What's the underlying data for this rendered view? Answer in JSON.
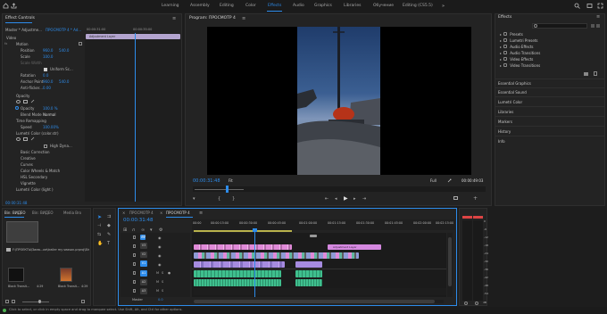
{
  "workspaces": [
    "Learning",
    "Assembly",
    "Editing",
    "Color",
    "Effects",
    "Audio",
    "Graphics",
    "Libraries",
    "Обучение",
    "Editing (CS5.5)"
  ],
  "active_workspace": "Effects",
  "effect_controls": {
    "title": "Effect Controls",
    "source": "Master * Adjustme...",
    "clip": "ПРОСМОТР 4 * Ad...",
    "mini_time": "00:00:31:00",
    "mini_time2": "00:00:35:00",
    "mini_clip_label": "Adjustment Layer",
    "section_video": "Video",
    "motion": "Motion",
    "position_label": "Position",
    "position_x": "960.0",
    "position_y": "540.0",
    "scale_label": "Scale",
    "scale_value": "100.0",
    "scale_width_label": "Scale Width",
    "uniform_scale": "Uniform Sc...",
    "rotation_label": "Rotation",
    "rotation_value": "0.0",
    "anchor_label": "Anchor Point",
    "anchor_x": "960.0",
    "anchor_y": "540.0",
    "antiflicker_label": "Anti-flicker...",
    "antiflicker_value": "0.00",
    "opacity": "Opacity",
    "opacity_label": "Opacity",
    "opacity_value": "100.0 %",
    "blend_label": "Blend Mode",
    "blend_value": "Normal",
    "time_remap": "Time Remapping",
    "speed_label": "Speed",
    "speed_value": "100.00%",
    "lumetri": "Lumetri Color (color.str)",
    "high_dynamic": "High Dyna...",
    "lumetri_sections": [
      "Basic Correction",
      "Creative",
      "Curves",
      "Color Wheels & Match",
      "HSL Secondary",
      "Vignette"
    ],
    "lumetri2": "Lumetri Color (light )",
    "footer_time": "00:00:31:48"
  },
  "program": {
    "title": "Program: ПРОСМОТР 4",
    "timecode": "00:00:31:48",
    "fit": "Fit",
    "quality": "Full",
    "duration": "00:00:49:03"
  },
  "effects_panel": {
    "title": "Effects",
    "tree": [
      "Presets",
      "Lumetri Presets",
      "Audio Effects",
      "Audio Transitions",
      "Video Effects",
      "Video Transitions"
    ],
    "sections": [
      "Essential Graphics",
      "Essential Sound",
      "Lumetri Color",
      "Libraries",
      "Markers",
      "History",
      "Info"
    ]
  },
  "project": {
    "tabs": [
      "Bin: ВИДЕО",
      "Bin: ВИДЕО",
      "Media Bro"
    ],
    "path": "F:\\ПРОЕКТЫ\\Зима...ие\\trailer my season.prproj\\Bin:",
    "items": [
      {
        "name": "Black Transit...",
        "dur": "4:29"
      },
      {
        "name": "Black Transit...",
        "dur": "4:29"
      }
    ]
  },
  "timeline": {
    "tabs": [
      "ПРОСМОТР 4",
      "ПРОСМОТР 4"
    ],
    "timecode": "00:00:31:48",
    "ruler": [
      "00:00",
      "00:00:15:00",
      "00:00:30:00",
      "00:00:45:00",
      "00:01:00:00",
      "00:01:15:00",
      "00:01:30:00",
      "00:01:45:00",
      "00:02:00:00",
      "00:02:15:00"
    ],
    "tracks": [
      "V4",
      "V3",
      "V2",
      "V1",
      "A1",
      "A2",
      "A3"
    ],
    "master": "Master",
    "master_value": "0.0",
    "clip_label": "Adjustment Layer"
  },
  "meter_scale": [
    "0",
    "-6",
    "-12",
    "-18",
    "-24",
    "-30",
    "-36",
    "-42",
    "-48",
    "-54"
  ],
  "meter_db": "dB",
  "status_bar": "Click to select, or click in empty space and drag to marquee select. Use Shift, Alt, and Ctrl for other options.",
  "colors": {
    "accent": "#2d8ceb",
    "panel": "#232323",
    "clip_pink": "#e08ad8",
    "clip_green": "#3fbf8e",
    "clip_violet": "#a68be0"
  }
}
